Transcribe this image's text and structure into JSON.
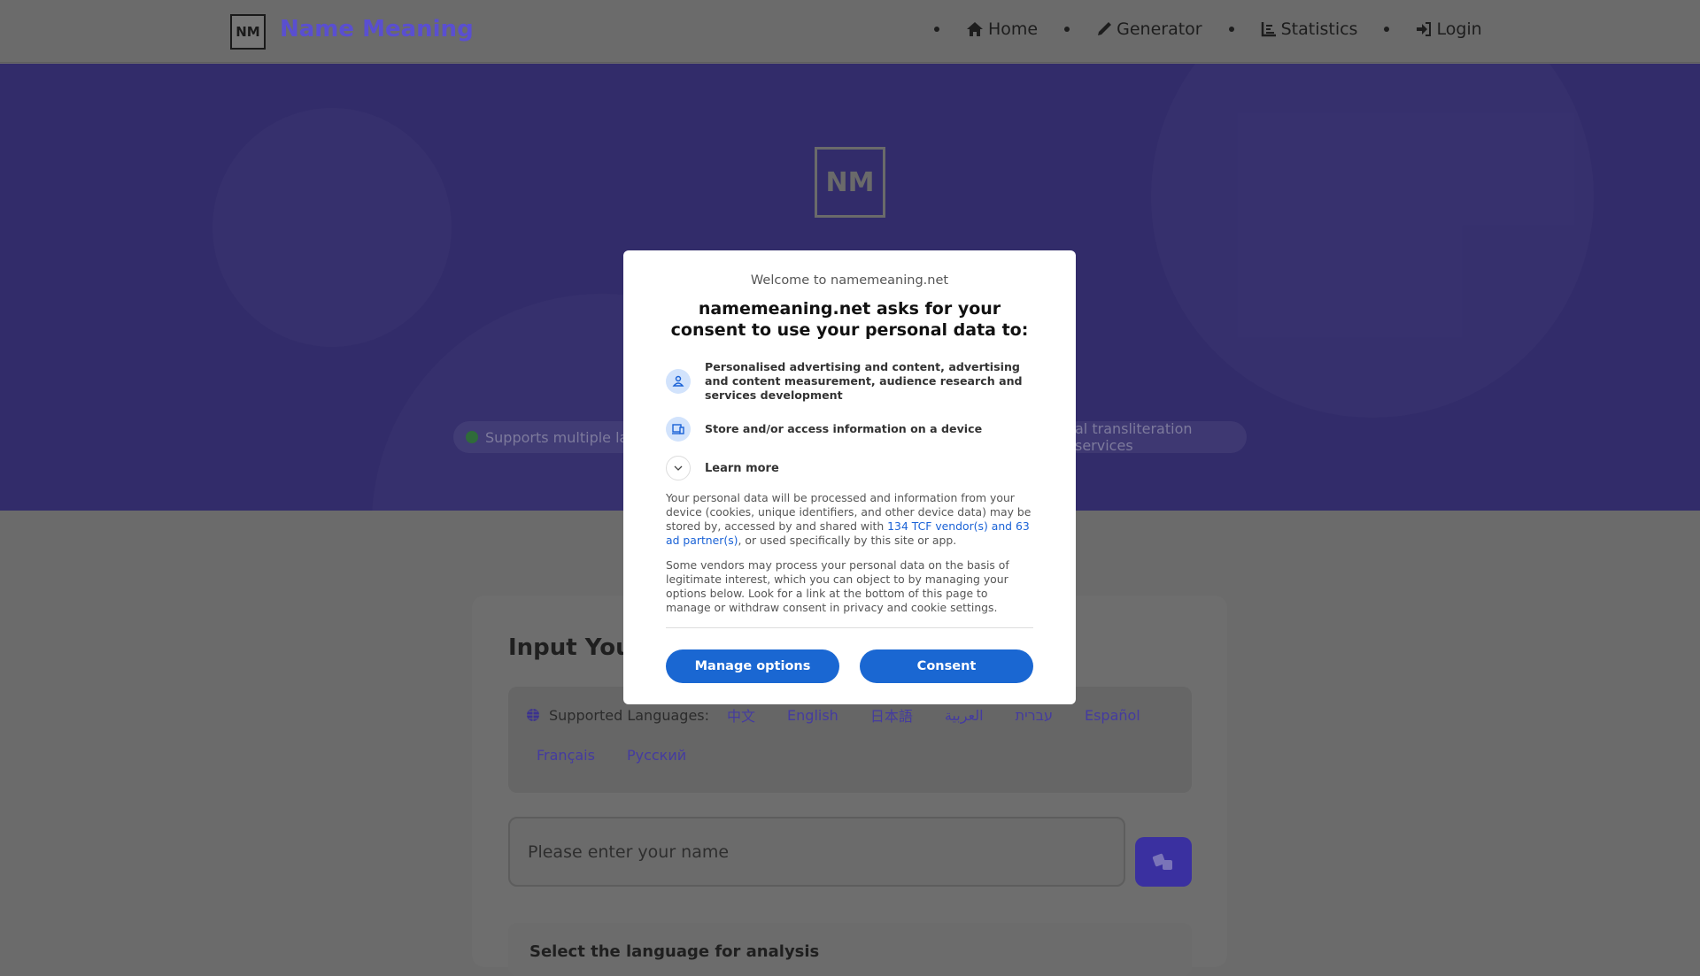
{
  "nav": {
    "logo": "NM",
    "brand": "Name Meaning",
    "items": [
      {
        "label": "Home",
        "icon": "home-icon"
      },
      {
        "label": "Generator",
        "icon": "pencil-icon"
      },
      {
        "label": "Statistics",
        "icon": "chart-icon"
      },
      {
        "label": "Login",
        "icon": "login-icon"
      }
    ]
  },
  "hero": {
    "logo": "NM",
    "badge_left": "Supports multiple lan",
    "badge_right": "al transliteration services"
  },
  "main": {
    "heading": "Input Your",
    "languages_label": "Supported Languages:",
    "languages": [
      "中文",
      "English",
      "日本語",
      "العربية",
      "עברית",
      "Español",
      "Français",
      "Русский"
    ],
    "name_placeholder": "Please enter your name",
    "select_title": "Select the language for analysis"
  },
  "consent": {
    "welcome": "Welcome to namemeaning.net",
    "title": "namemeaning.net asks for your consent to use your personal data to:",
    "purposes": [
      "Personalised advertising and content, advertising and content measurement, audience research and services development",
      "Store and/or access information on a device"
    ],
    "learn_more": "Learn more",
    "para1_a": "Your personal data will be processed and information from your device (cookies, unique identifiers, and other device data) may be stored by, accessed by and shared with ",
    "para1_link": "134 TCF vendor(s) and 63 ad partner(s)",
    "para1_b": ", or used specifically by this site or app.",
    "para2": "Some vendors may process your personal data on the basis of legitimate interest, which you can object to by managing your options below. Look for a link at the bottom of this page to manage or withdraw consent in privacy and cookie settings.",
    "manage_label": "Manage options",
    "consent_label": "Consent"
  },
  "colors": {
    "brand": "#5a4fd0",
    "consent_button": "#1a67d2",
    "link": "#1a62d6"
  }
}
